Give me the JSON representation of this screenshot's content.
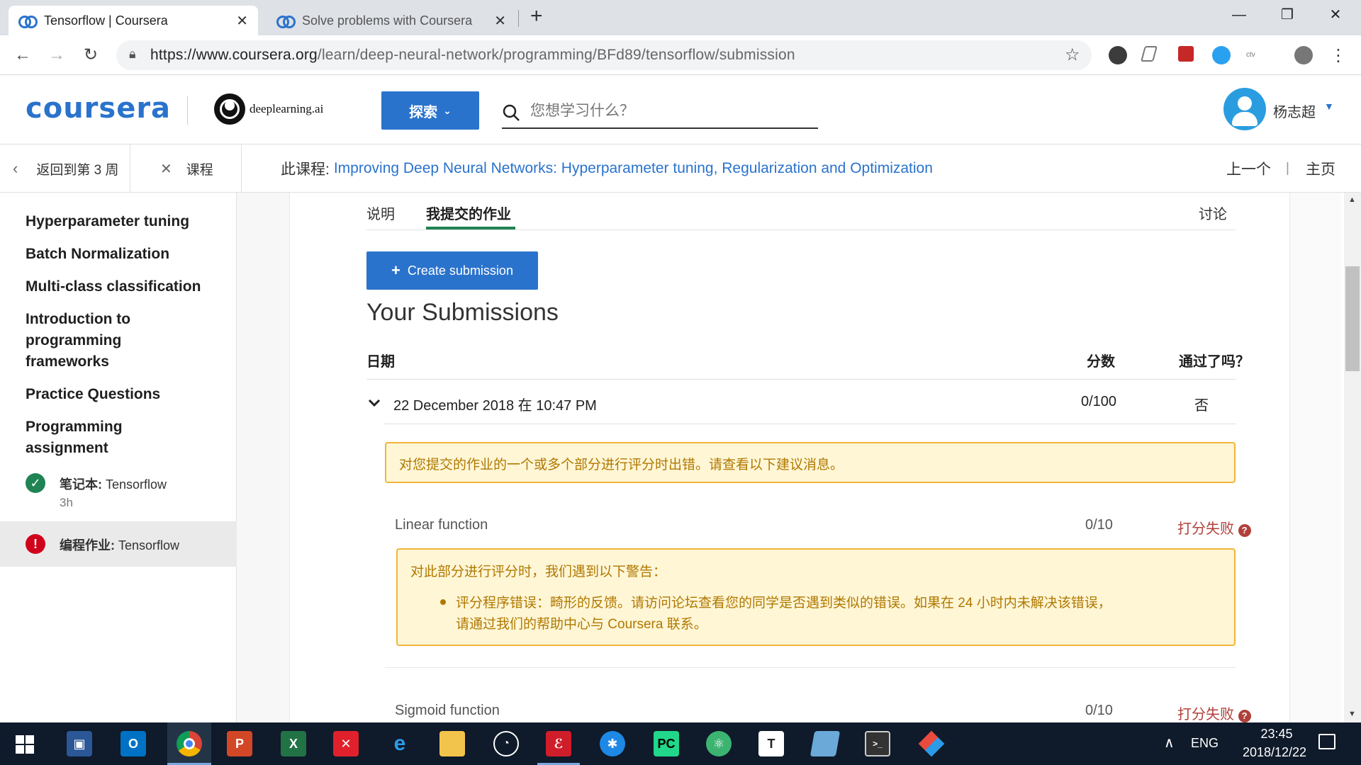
{
  "browser": {
    "tabs": [
      {
        "title": "Tensorflow | Coursera",
        "active": true
      },
      {
        "title": "Solve problems with Coursera",
        "active": false
      }
    ],
    "new_tab": "+",
    "url_host": "https://www.coursera.org",
    "url_path": "/learn/deep-neural-network/programming/BFd89/tensorflow/submission"
  },
  "header": {
    "logo": "coursera",
    "partner": "deeplearning.ai",
    "explore_label": "探索",
    "search_placeholder": "您想学习什么？",
    "user_name": "杨志超"
  },
  "course_nav": {
    "back_label": "返回到第 3 周",
    "course_label": "课程",
    "course_prefix": "此课程:",
    "course_title": "Improving Deep Neural Networks: Hyperparameter tuning, Regularization and Optimization",
    "prev_label": "上一个",
    "divider": "|",
    "home_label": "主页"
  },
  "sidebar": {
    "items": [
      "Hyperparameter tuning",
      "Batch Normalization",
      "Multi-class classification",
      "Introduction to programming frameworks",
      "Practice Questions",
      "Programming assignment"
    ],
    "lessons": [
      {
        "type": "笔记本:",
        "name": "Tensorflow",
        "duration": "3h",
        "status": "complete"
      },
      {
        "type": "编程作业:",
        "name": "Tensorflow",
        "status": "failed"
      }
    ]
  },
  "main": {
    "tabs": {
      "instructions": "说明",
      "my_submission": "我提交的作业",
      "discussion": "讨论"
    },
    "create_button": "Create submission",
    "create_icon": "+",
    "heading": "Your Submissions",
    "columns": {
      "date": "日期",
      "score": "分数",
      "passed": "通过了吗？"
    },
    "submission": {
      "date": "22 December 2018 在 10:47 PM",
      "score": "0/100",
      "passed": "否"
    },
    "error_banner": "对您提交的作业的一个或多个部分进行评分时出错。请查看以下建议消息。",
    "parts": [
      {
        "name": "Linear function",
        "score": "0/10",
        "status": "打分失败"
      },
      {
        "name": "Sigmoid function",
        "score": "0/10",
        "status": "打分失败"
      }
    ],
    "warning_title": "对此部分进行评分时，我们遇到以下警告：",
    "warning_bullet_1": "评分程序错误：畸形的反馈。请访问论坛查看您的同学是否遇到类似的错误。如果在 24 小时内未解决该错误，",
    "warning_bullet_2": "请通过我们的帮助中心与 Coursera 联系。"
  },
  "taskbar": {
    "lang": "ENG",
    "time": "23:45",
    "date": "2018/12/22"
  },
  "colors": {
    "accent": "#2a73cc",
    "success": "#1f8354",
    "error": "#d0021b",
    "warning_text": "#b07800",
    "fail_text": "#b1403a"
  }
}
